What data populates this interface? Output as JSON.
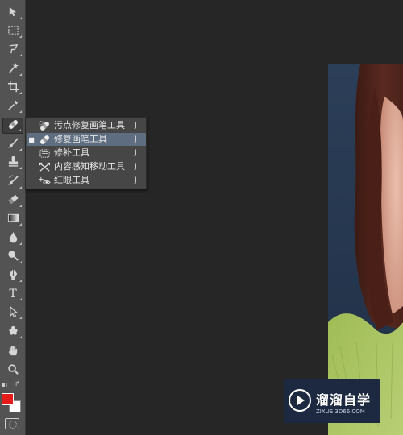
{
  "toolbar": {
    "tools": [
      {
        "name": "move-tool",
        "icon": "move-icon",
        "glyph": "▸"
      },
      {
        "name": "marquee-tool",
        "icon": "rectangular-marquee-icon",
        "glyph": "⬚"
      },
      {
        "name": "lasso-tool",
        "icon": "lasso-icon",
        "glyph": "ℓ"
      },
      {
        "name": "magic-wand-tool",
        "icon": "magic-wand-icon",
        "glyph": "✱"
      },
      {
        "name": "crop-tool",
        "icon": "crop-icon",
        "glyph": "⌗"
      },
      {
        "name": "eyedropper-tool",
        "icon": "eyedropper-icon",
        "glyph": "⁄"
      },
      {
        "name": "healing-brush-tool",
        "icon": "bandage-icon",
        "glyph": ""
      },
      {
        "name": "brush-tool",
        "icon": "brush-icon",
        "glyph": "∕"
      },
      {
        "name": "clone-stamp-tool",
        "icon": "stamp-icon",
        "glyph": "⊥"
      },
      {
        "name": "history-brush-tool",
        "icon": "history-brush-icon",
        "glyph": "↺"
      },
      {
        "name": "eraser-tool",
        "icon": "eraser-icon",
        "glyph": "◪"
      },
      {
        "name": "gradient-tool",
        "icon": "gradient-icon",
        "glyph": "▭"
      },
      {
        "name": "blur-tool",
        "icon": "drop-icon",
        "glyph": "●"
      },
      {
        "name": "dodge-tool",
        "icon": "dodge-icon",
        "glyph": "◔"
      },
      {
        "name": "pen-tool",
        "icon": "pen-icon",
        "glyph": "✒"
      },
      {
        "name": "type-tool",
        "icon": "type-icon",
        "glyph": "T"
      },
      {
        "name": "path-selection-tool",
        "icon": "path-selection-icon",
        "glyph": "➤"
      },
      {
        "name": "shape-tool",
        "icon": "custom-shape-icon",
        "glyph": "✿"
      },
      {
        "name": "hand-tool",
        "icon": "hand-icon",
        "glyph": "✋"
      },
      {
        "name": "zoom-tool",
        "icon": "zoom-icon",
        "glyph": "⚲"
      }
    ],
    "foreground_color": "#e51c1c",
    "background_color": "#ffffff"
  },
  "flyout": {
    "items": [
      {
        "label": "污点修复画笔工具",
        "shortcut": "J",
        "icon": "spot-healing-brush-icon",
        "selected": false
      },
      {
        "label": "修复画笔工具",
        "shortcut": "J",
        "icon": "healing-brush-icon",
        "selected": true
      },
      {
        "label": "修补工具",
        "shortcut": "J",
        "icon": "patch-icon",
        "selected": false
      },
      {
        "label": "内容感知移动工具",
        "shortcut": "J",
        "icon": "content-aware-move-icon",
        "selected": false
      },
      {
        "label": "红眼工具",
        "shortcut": "J",
        "icon": "red-eye-icon",
        "selected": false
      }
    ],
    "active_bullet": "■"
  },
  "watermark": {
    "title": "溜溜自学",
    "url": "ZIXUE.3D66.COM"
  },
  "colors": {
    "canvas_bg": "#262626",
    "toolbar_bg": "#535353",
    "menu_bg": "#464646",
    "menu_selected": "#5e6d80",
    "watermark_bg": "#1c2940"
  }
}
